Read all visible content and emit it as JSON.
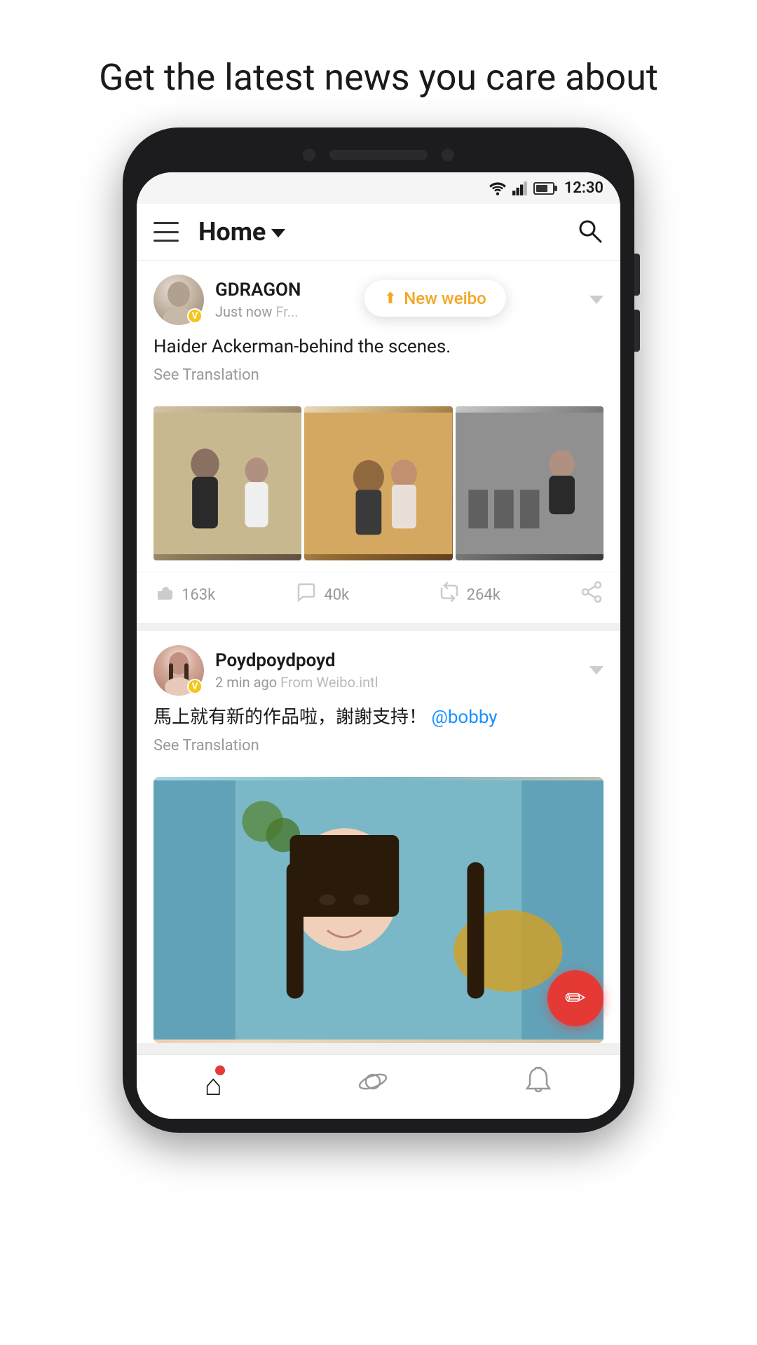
{
  "page": {
    "headline": "Get the latest news you care about"
  },
  "status_bar": {
    "time": "12:30"
  },
  "header": {
    "title": "Home",
    "menu_label": "menu",
    "search_label": "search"
  },
  "posts": [
    {
      "id": "post1",
      "username": "GDRAGON",
      "time": "Just now",
      "source": "Fr...",
      "text": "Haider Ackerman-behind the scenes.",
      "see_translation": "See Translation",
      "likes": "163k",
      "comments": "40k",
      "reposts": "264k",
      "verified": "V",
      "tooltip": "New weibo"
    },
    {
      "id": "post2",
      "username": "Poydpoydpoyd",
      "time": "2 min ago",
      "source": "From Weibo.intl",
      "text": "馬上就有新的作品啦，謝謝支持！",
      "mention": "@bobby",
      "see_translation": "See Translation",
      "verified": "V"
    }
  ],
  "bottom_nav": {
    "home_label": "home",
    "discover_label": "discover",
    "notifications_label": "notifications"
  },
  "fab": {
    "icon": "edit"
  }
}
